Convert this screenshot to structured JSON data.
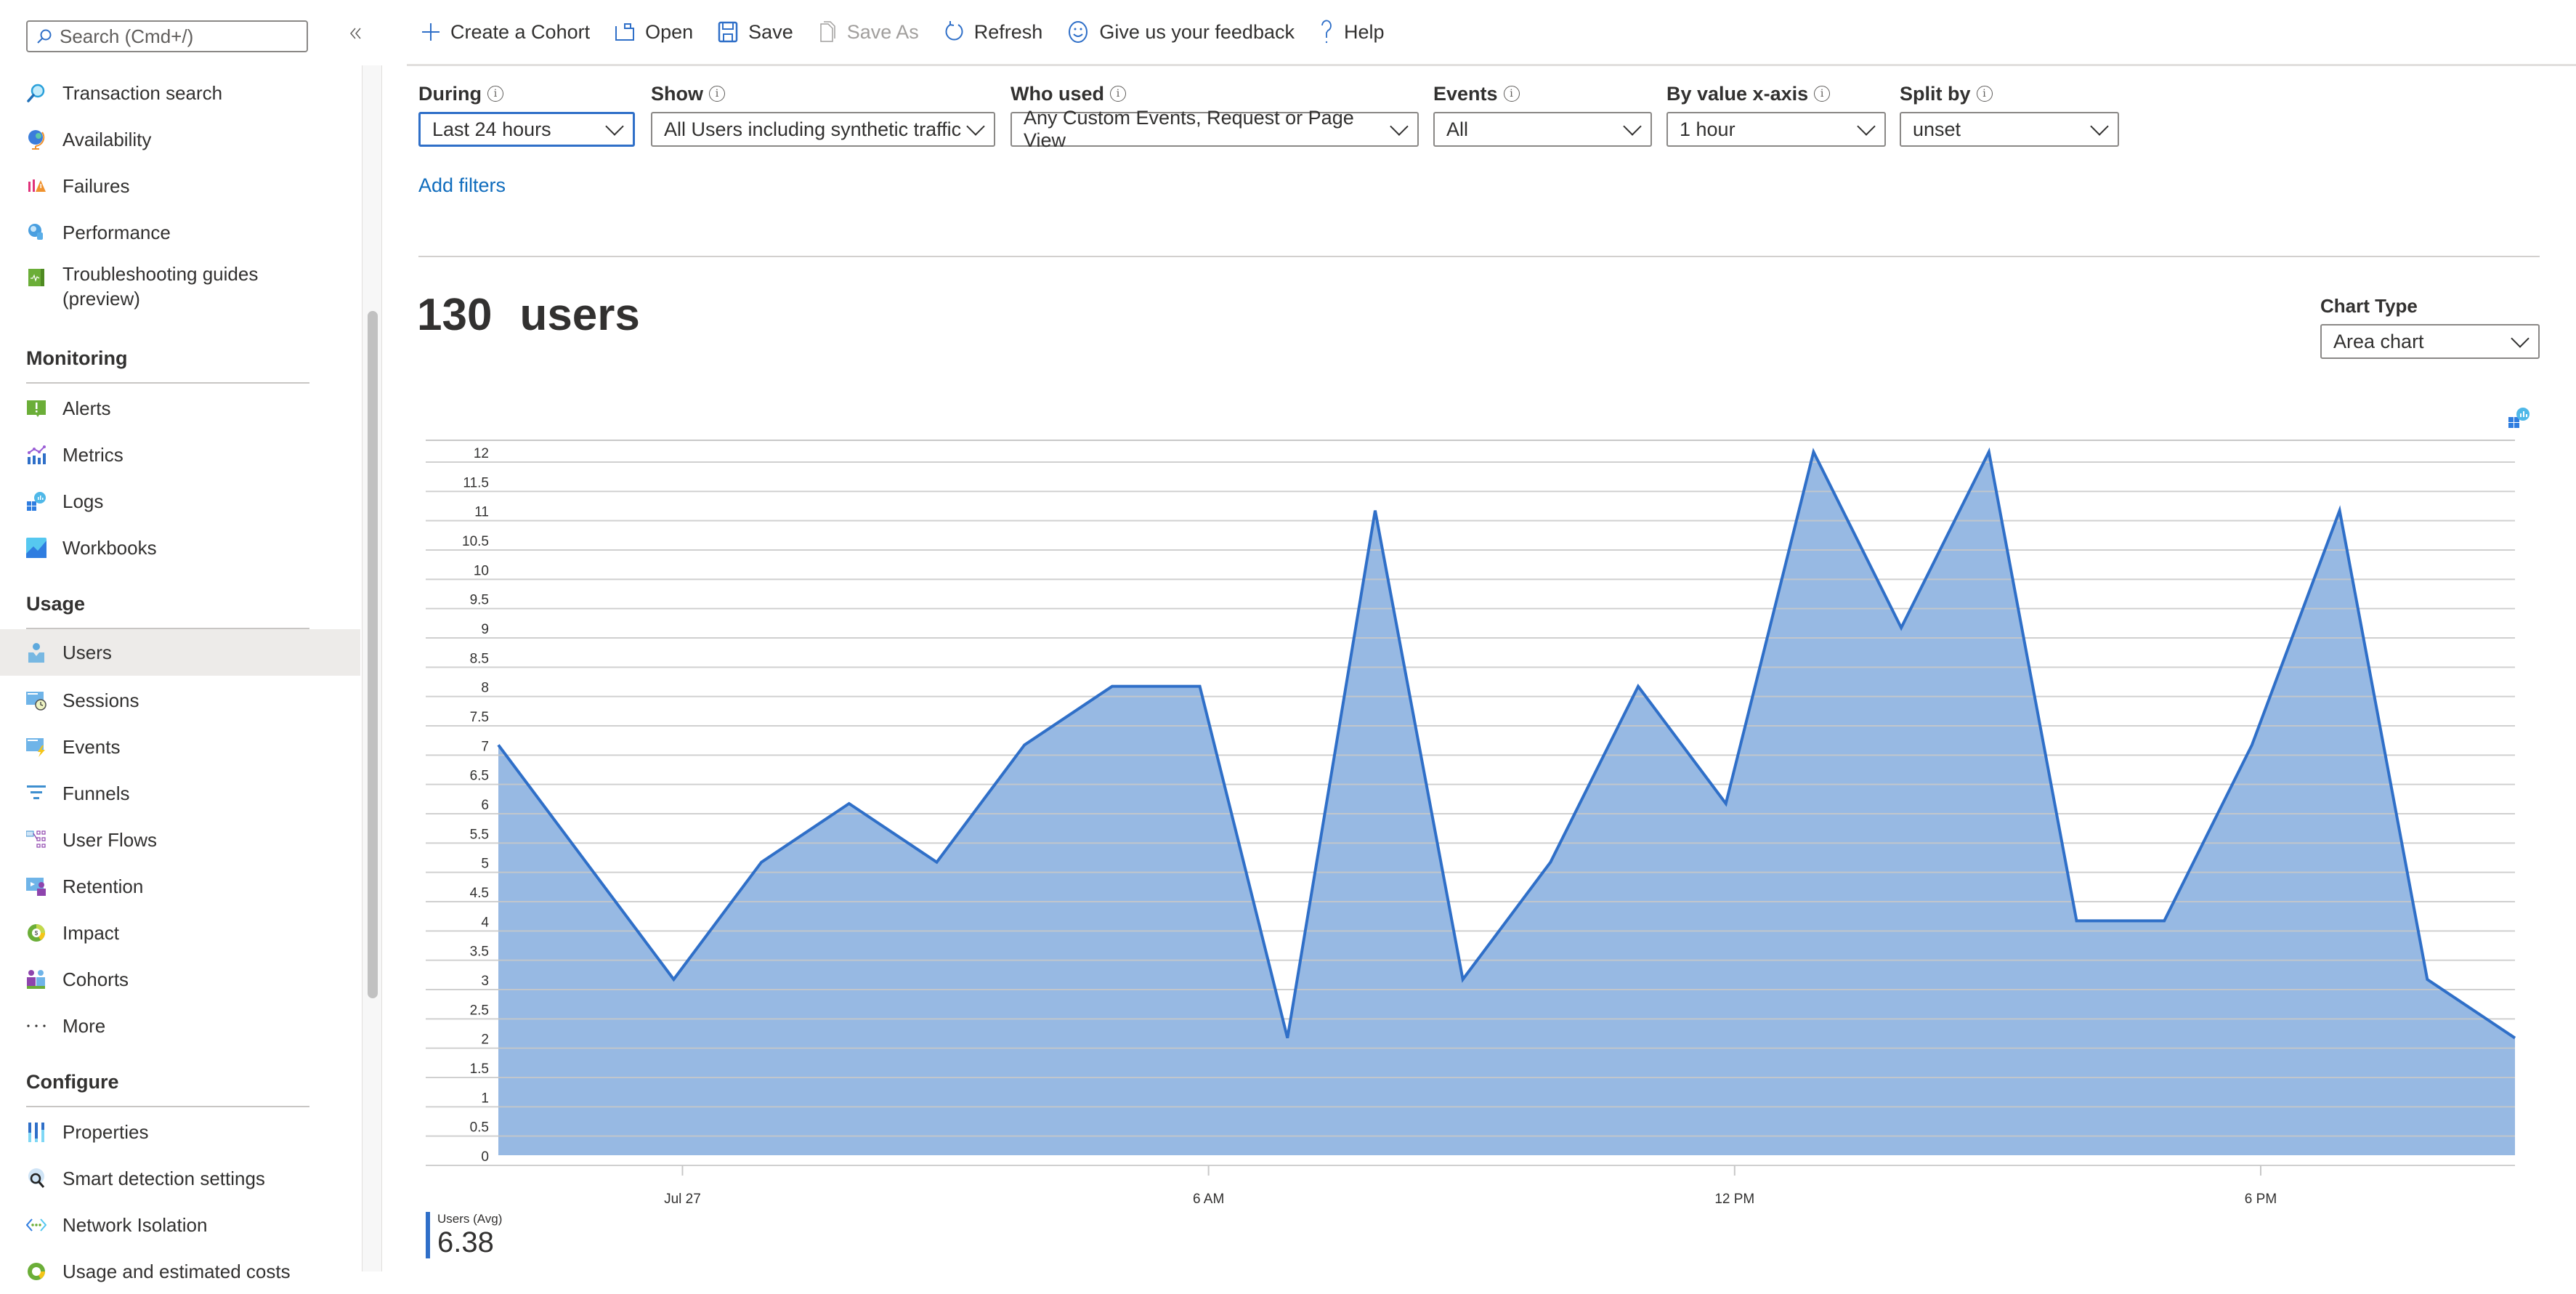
{
  "sidebar": {
    "search_placeholder": "Search (Cmd+/)",
    "collapse_icon": "double-chevron-left",
    "top_items": [
      {
        "label": "Transaction search",
        "icon": "magnifier-icon"
      },
      {
        "label": "Availability",
        "icon": "globe-icon"
      },
      {
        "label": "Failures",
        "icon": "failures-chart-icon"
      },
      {
        "label": "Performance",
        "icon": "performance-icon"
      },
      {
        "label": "Troubleshooting guides",
        "label2": "(preview)",
        "icon": "guide-book-icon"
      }
    ],
    "sections": [
      {
        "title": "Monitoring",
        "items": [
          {
            "label": "Alerts",
            "icon": "alert-icon"
          },
          {
            "label": "Metrics",
            "icon": "metrics-icon"
          },
          {
            "label": "Logs",
            "icon": "logs-icon"
          },
          {
            "label": "Workbooks",
            "icon": "workbooks-icon"
          }
        ]
      },
      {
        "title": "Usage",
        "items": [
          {
            "label": "Users",
            "icon": "user-icon",
            "active": true
          },
          {
            "label": "Sessions",
            "icon": "sessions-icon"
          },
          {
            "label": "Events",
            "icon": "events-icon"
          },
          {
            "label": "Funnels",
            "icon": "funnel-icon"
          },
          {
            "label": "User Flows",
            "icon": "user-flows-icon"
          },
          {
            "label": "Retention",
            "icon": "retention-icon"
          },
          {
            "label": "Impact",
            "icon": "impact-icon"
          },
          {
            "label": "Cohorts",
            "icon": "cohorts-icon"
          },
          {
            "label": "More",
            "icon": "more-icon"
          }
        ]
      },
      {
        "title": "Configure",
        "items": [
          {
            "label": "Properties",
            "icon": "properties-icon"
          },
          {
            "label": "Smart detection settings",
            "icon": "smart-detection-icon"
          },
          {
            "label": "Network Isolation",
            "icon": "network-icon"
          },
          {
            "label": "Usage and estimated costs",
            "icon": "cost-icon"
          }
        ]
      }
    ]
  },
  "toolbar": {
    "create_cohort": "Create a Cohort",
    "open": "Open",
    "save": "Save",
    "save_as": "Save As",
    "refresh": "Refresh",
    "feedback": "Give us your feedback",
    "help": "Help"
  },
  "filters": {
    "during": {
      "label": "During",
      "value": "Last 24 hours"
    },
    "show": {
      "label": "Show",
      "value": "All Users including synthetic traffic"
    },
    "who_used": {
      "label": "Who used",
      "value": "Any Custom Events, Request or Page View"
    },
    "events": {
      "label": "Events",
      "value": "All"
    },
    "by_value": {
      "label": "By value x-axis",
      "value": "1 hour"
    },
    "split_by": {
      "label": "Split by",
      "value": "unset"
    },
    "add_filters": "Add filters"
  },
  "summary": {
    "count": "130",
    "unit": "users"
  },
  "chart_type": {
    "label": "Chart Type",
    "value": "Area chart"
  },
  "legend": {
    "name": "Users (Avg)",
    "value": "6.38"
  },
  "colors": {
    "accent": "#2f6fc8",
    "area_fill": "#97b9e3",
    "grid": "#c8c8c8"
  },
  "chart_data": {
    "type": "area",
    "title": "",
    "xlabel": "",
    "ylabel": "",
    "series": [
      {
        "name": "Users (Avg)",
        "values": [
          7,
          5,
          3,
          5,
          6,
          5,
          7,
          8,
          8,
          2,
          11,
          3,
          5,
          8,
          6,
          12,
          9,
          12,
          4,
          4,
          7,
          11,
          3,
          2
        ]
      }
    ],
    "x_tick_labels": [
      {
        "label": "Jul 27",
        "index": 2.1
      },
      {
        "label": "6 AM",
        "index": 8.1
      },
      {
        "label": "12 PM",
        "index": 14.1
      },
      {
        "label": "6 PM",
        "index": 20.1
      }
    ],
    "y_ticks": [
      0,
      0.5,
      1,
      1.5,
      2,
      2.5,
      3,
      3.5,
      4,
      4.5,
      5,
      5.5,
      6,
      6.5,
      7,
      7.5,
      8,
      8.5,
      9,
      9.5,
      10,
      10.5,
      11,
      11.5,
      12
    ],
    "ylim": [
      0,
      12.3
    ],
    "grid": true,
    "legend_position": "bottom-left"
  }
}
